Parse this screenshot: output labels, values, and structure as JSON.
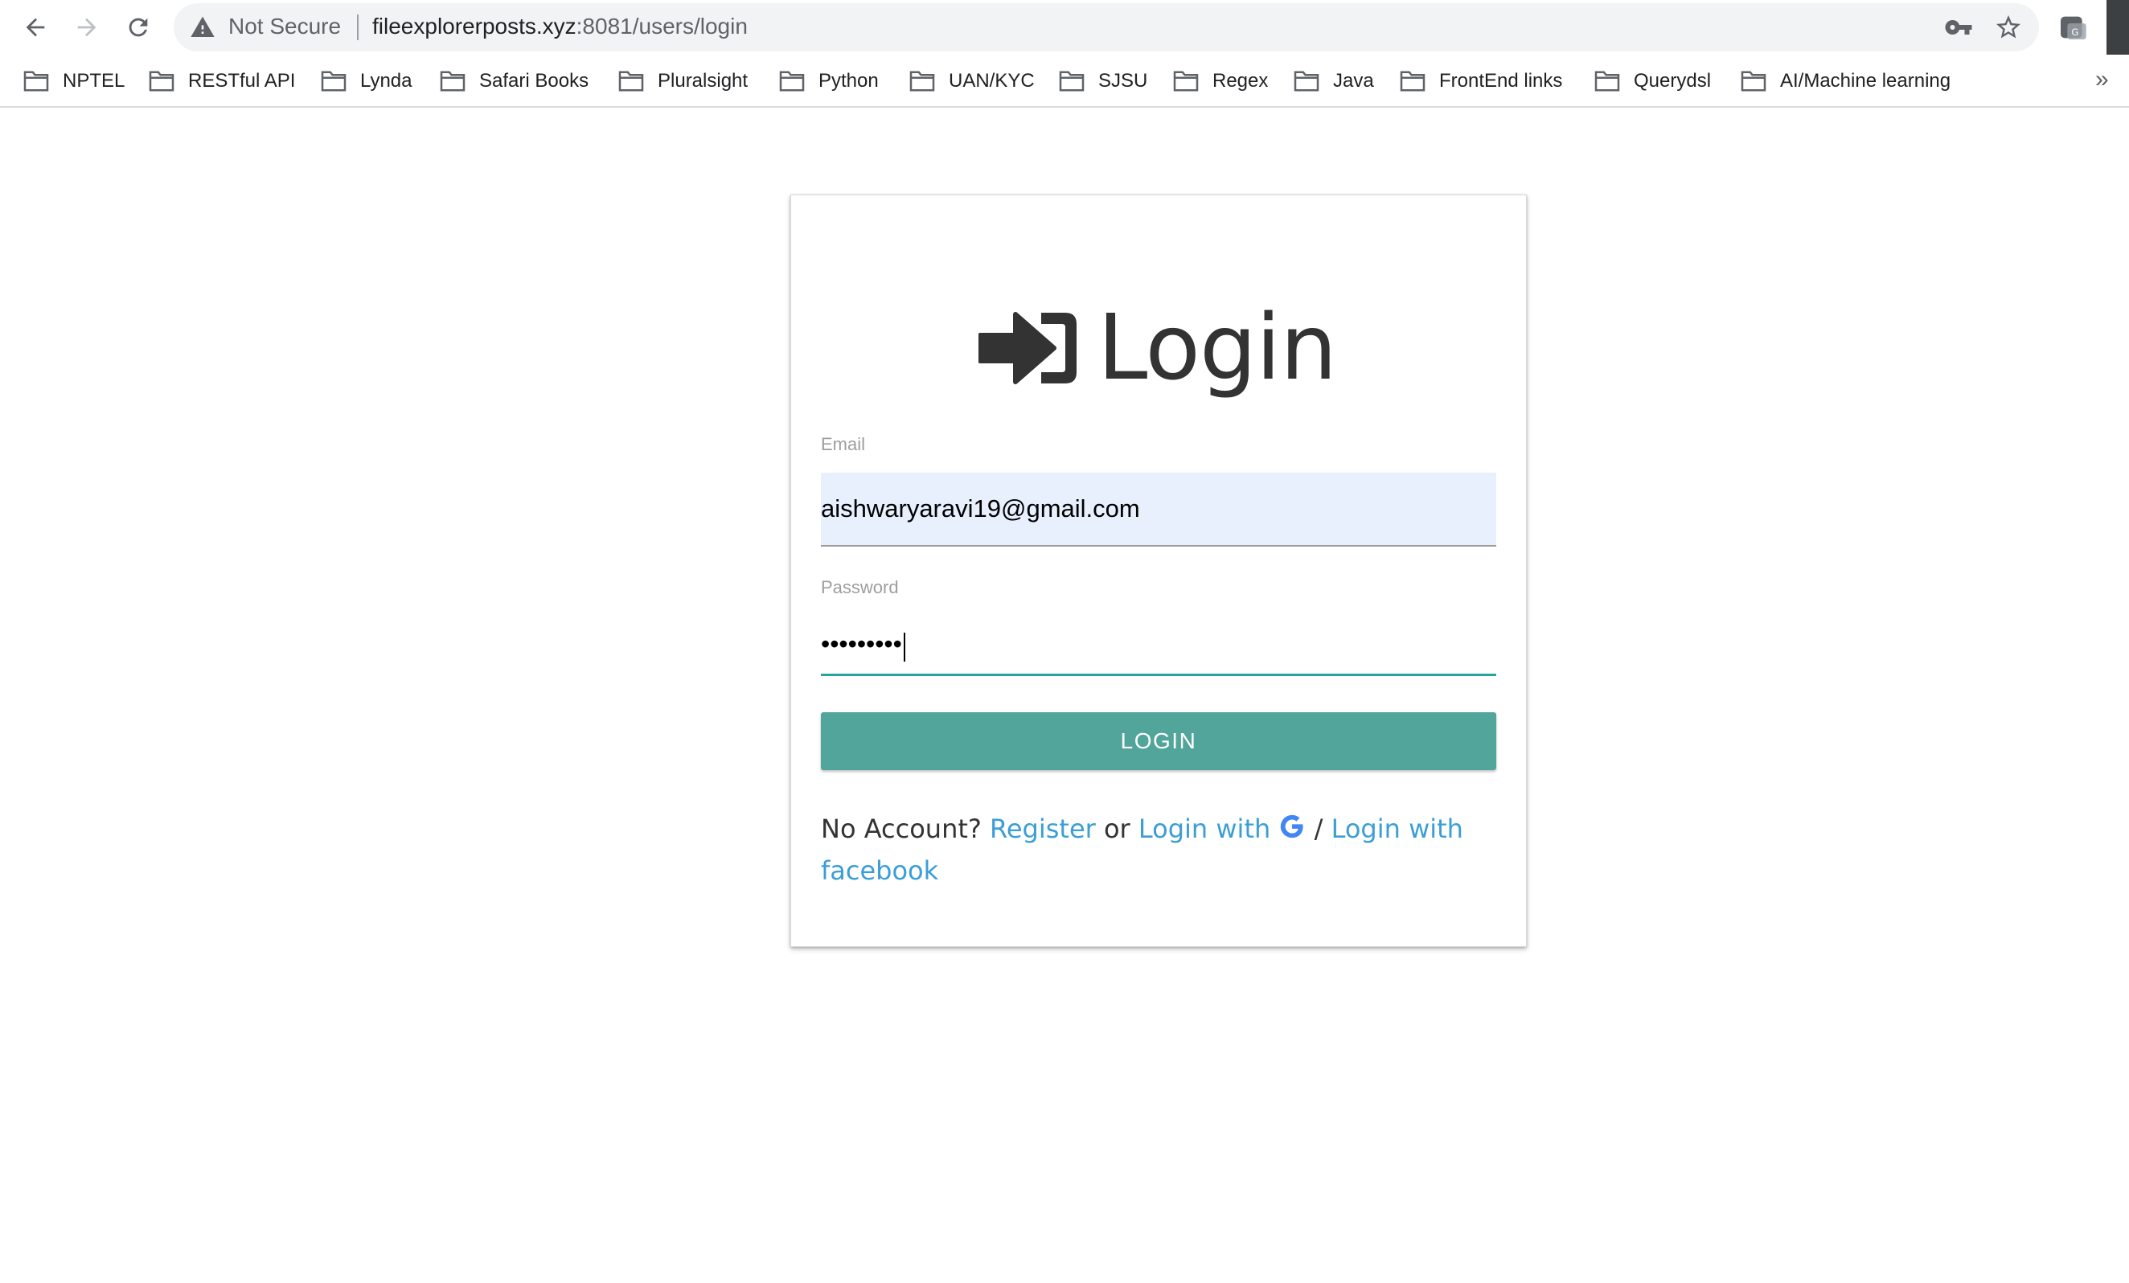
{
  "browser": {
    "nav": {
      "back_icon": "arrow-left-icon",
      "forward_icon": "arrow-right-icon",
      "reload_icon": "reload-icon"
    },
    "omnibox": {
      "security_label": "Not Secure",
      "url_host": "fileexplorerposts.xyz",
      "url_rest": ":8081/users/login",
      "key_icon": "key-icon",
      "star_icon": "star-icon"
    },
    "bookmarks": [
      {
        "label": "NPTEL",
        "icon": "folder-icon"
      },
      {
        "label": "RESTful API",
        "icon": "folder-icon"
      },
      {
        "label": "Lynda",
        "icon": "folder-icon"
      },
      {
        "label": "Safari Books",
        "icon": "folder-icon"
      },
      {
        "label": "Pluralsight",
        "icon": "folder-icon"
      },
      {
        "label": "Python",
        "icon": "folder-icon"
      },
      {
        "label": "UAN/KYC",
        "icon": "folder-icon"
      },
      {
        "label": "SJSU",
        "icon": "folder-icon"
      },
      {
        "label": "Regex",
        "icon": "folder-icon"
      },
      {
        "label": "Java",
        "icon": "folder-icon"
      },
      {
        "label": "FrontEnd links",
        "icon": "folder-icon"
      },
      {
        "label": "Querydsl",
        "icon": "folder-icon"
      },
      {
        "label": "AI/Machine learning",
        "icon": "folder-icon"
      }
    ],
    "bookmarks_overflow": "»"
  },
  "login": {
    "title": "Login",
    "title_icon": "sign-in-icon",
    "email_label": "Email",
    "email_value": "aishwaryaravi19@gmail.com",
    "password_label": "Password",
    "password_value": "•••••••••",
    "button_label": "LOGIN",
    "footer": {
      "prefix": "No Account?",
      "register_link": "Register",
      "or": "or",
      "login_with": "Login with",
      "google_icon": "google-icon",
      "slash": "/",
      "facebook_link": "Login with facebook"
    }
  },
  "colors": {
    "accent": "#52a59a",
    "focus_underline": "#26a69a",
    "link": "#3b9ed6",
    "autofill_bg": "#e8f0fe",
    "google_blue": "#4285f4"
  }
}
